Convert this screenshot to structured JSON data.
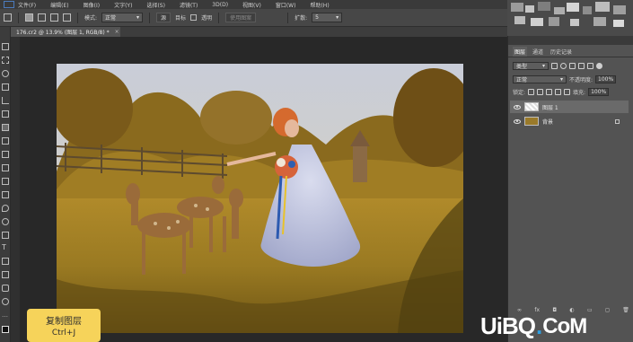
{
  "menu": {
    "items": [
      "文件(F)",
      "编辑(E)",
      "图像(I)",
      "文字(Y)",
      "选择(S)",
      "滤镜(T)",
      "3D(D)",
      "视图(V)",
      "窗口(W)",
      "帮助(H)"
    ]
  },
  "options": {
    "feather_label": "模式:",
    "mode_value": "正常",
    "btn_source": "源",
    "btn_target": "目标",
    "transparent_label": "透明",
    "use_pattern": "使用图案",
    "diffusion_label": "扩散:",
    "diffusion_value": "5"
  },
  "document": {
    "tab_title": "176.cr2 @ 13.9% (图层 1, RGB/8) *",
    "close": "×"
  },
  "panels": {
    "tabs": [
      "图层",
      "通道",
      "历史记录"
    ],
    "filter_kind": "类型",
    "blend_mode": "正常",
    "opacity_label": "不透明度:",
    "opacity_value": "100%",
    "lock_label": "锁定:",
    "fill_label": "填充:",
    "fill_value": "100%",
    "layers": [
      {
        "name": "图层 1",
        "selected": true
      },
      {
        "name": "背景",
        "selected": false
      }
    ],
    "bottom_icons": [
      "link-icon",
      "fx-icon",
      "mask-icon",
      "adjustment-icon",
      "folder-icon",
      "new-layer-icon",
      "trash-icon"
    ]
  },
  "tooltip": {
    "title": "复制图层",
    "shortcut": "Ctrl+J"
  },
  "watermark": {
    "part1": "UiBQ",
    "dot": ".",
    "part2": "CoM"
  },
  "colors": {
    "ui_dark": "#3a3a3a",
    "ui_mid": "#535353",
    "tooltip": "#f6d35a",
    "watermark_accent": "#2e9ee0"
  }
}
